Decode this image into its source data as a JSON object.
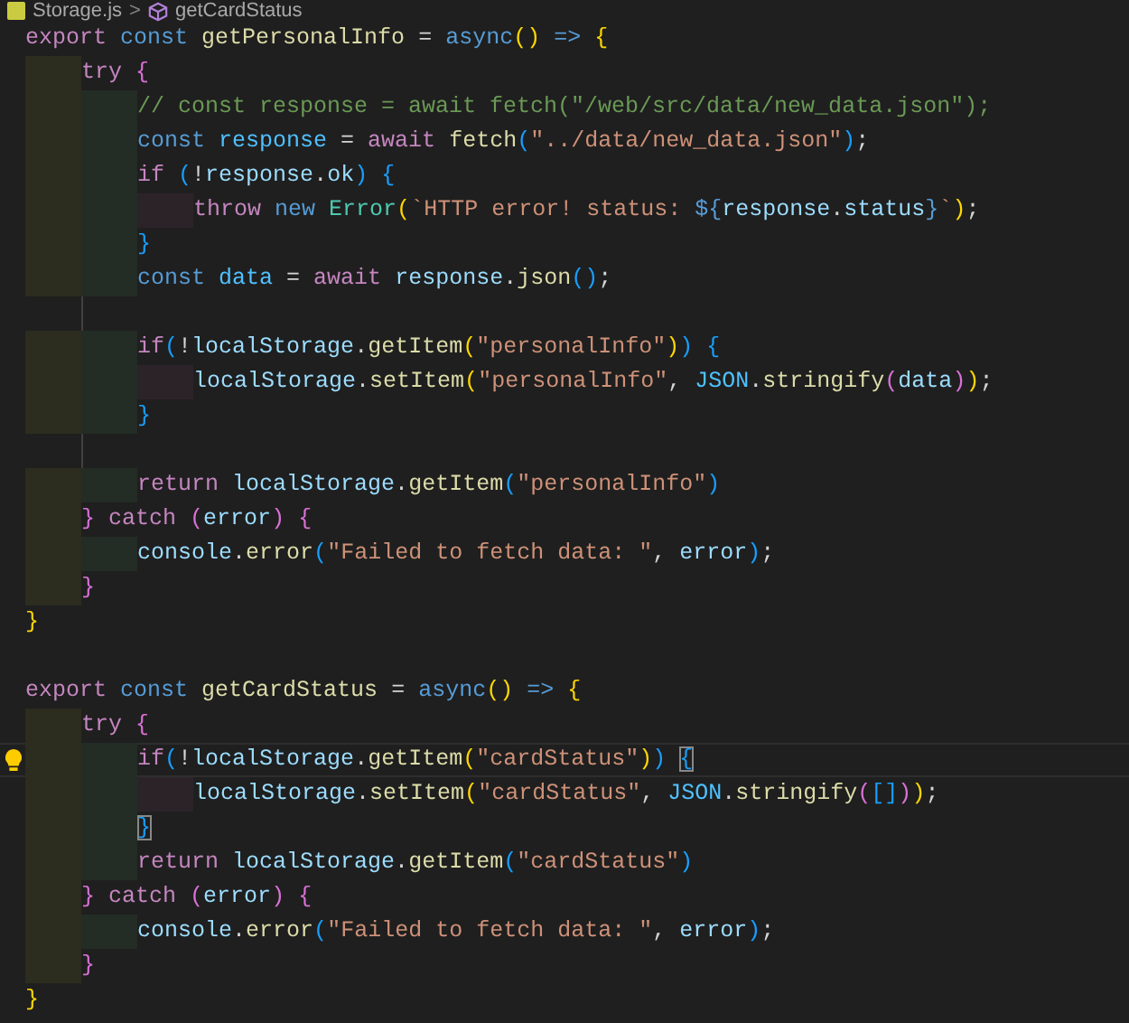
{
  "breadcrumb": {
    "file": "Storage.js",
    "separator": ">",
    "symbol": "getCardStatus"
  },
  "lines": [
    {
      "tokens": [
        {
          "t": "export",
          "kind": "control"
        },
        {
          "t": " const ",
          "kind": "keyword"
        },
        {
          "t": "getPersonalInfo",
          "kind": "function"
        },
        {
          "t": " = ",
          "kind": "plain"
        },
        {
          "t": "async",
          "kind": "keyword"
        },
        {
          "t": "()",
          "kind": "bracket1"
        },
        {
          "t": " => ",
          "kind": "keyword"
        },
        {
          "t": "{",
          "kind": "bracket1"
        }
      ]
    },
    {
      "guides": [
        {
          "color": "#2c2c1f"
        }
      ],
      "tokens": [
        {
          "t": "try",
          "kind": "control"
        },
        {
          "t": " {",
          "kind": "bracket2"
        }
      ]
    },
    {
      "guides": [
        {
          "color": "#2c2c1f"
        },
        {
          "color": "#232c25"
        }
      ],
      "tokens": [
        {
          "t": "// const response = await fetch(\"/web/src/data/new_data.json\");",
          "kind": "comment"
        }
      ]
    },
    {
      "guides": [
        {
          "color": "#2c2c1f"
        },
        {
          "color": "#232c25"
        }
      ],
      "tokens": [
        {
          "t": "const",
          "kind": "keyword"
        },
        {
          "t": " response",
          "kind": "constant"
        },
        {
          "t": " = ",
          "kind": "plain"
        },
        {
          "t": "await",
          "kind": "control"
        },
        {
          "t": " fetch",
          "kind": "function"
        },
        {
          "t": "(",
          "kind": "bracket3"
        },
        {
          "t": "\"../data/new_data.json\"",
          "kind": "string"
        },
        {
          "t": ")",
          "kind": "bracket3"
        },
        {
          "t": ";",
          "kind": "plain"
        }
      ]
    },
    {
      "guides": [
        {
          "color": "#2c2c1f"
        },
        {
          "color": "#232c25"
        }
      ],
      "tokens": [
        {
          "t": "if ",
          "kind": "control"
        },
        {
          "t": "(",
          "kind": "bracket3"
        },
        {
          "t": "!",
          "kind": "plain"
        },
        {
          "t": "response",
          "kind": "variable"
        },
        {
          "t": ".",
          "kind": "plain"
        },
        {
          "t": "ok",
          "kind": "variable"
        },
        {
          "t": ")",
          "kind": "bracket3"
        },
        {
          "t": " {",
          "kind": "bracket3"
        }
      ]
    },
    {
      "guides": [
        {
          "color": "#2c2c1f"
        },
        {
          "color": "#232c25"
        },
        {
          "color": "#2c2329"
        }
      ],
      "tokens": [
        {
          "t": "throw",
          "kind": "control"
        },
        {
          "t": " new ",
          "kind": "keyword"
        },
        {
          "t": "Error",
          "kind": "type"
        },
        {
          "t": "(",
          "kind": "bracket1"
        },
        {
          "t": "`HTTP error! status: ",
          "kind": "string"
        },
        {
          "t": "${",
          "kind": "keyword"
        },
        {
          "t": "response",
          "kind": "variable"
        },
        {
          "t": ".",
          "kind": "plain"
        },
        {
          "t": "status",
          "kind": "variable"
        },
        {
          "t": "}",
          "kind": "keyword"
        },
        {
          "t": "`",
          "kind": "string"
        },
        {
          "t": ")",
          "kind": "bracket1"
        },
        {
          "t": ";",
          "kind": "plain"
        }
      ]
    },
    {
      "guides": [
        {
          "color": "#2c2c1f"
        },
        {
          "color": "#232c25"
        }
      ],
      "tokens": [
        {
          "t": "}",
          "kind": "bracket3"
        }
      ]
    },
    {
      "guides": [
        {
          "color": "#2c2c1f"
        },
        {
          "color": "#232c25"
        }
      ],
      "tokens": [
        {
          "t": "const",
          "kind": "keyword"
        },
        {
          "t": " data",
          "kind": "constant"
        },
        {
          "t": " = ",
          "kind": "plain"
        },
        {
          "t": "await",
          "kind": "control"
        },
        {
          "t": " response",
          "kind": "variable"
        },
        {
          "t": ".",
          "kind": "plain"
        },
        {
          "t": "json",
          "kind": "function"
        },
        {
          "t": "()",
          "kind": "bracket3"
        },
        {
          "t": ";",
          "kind": "plain"
        }
      ]
    },
    {
      "guide_line": true
    },
    {
      "guides": [
        {
          "color": "#2c2c1f"
        },
        {
          "color": "#232c25"
        }
      ],
      "tokens": [
        {
          "t": "if",
          "kind": "control"
        },
        {
          "t": "(",
          "kind": "bracket3"
        },
        {
          "t": "!",
          "kind": "plain"
        },
        {
          "t": "localStorage",
          "kind": "variable"
        },
        {
          "t": ".",
          "kind": "plain"
        },
        {
          "t": "getItem",
          "kind": "function"
        },
        {
          "t": "(",
          "kind": "bracket1"
        },
        {
          "t": "\"personalInfo\"",
          "kind": "string"
        },
        {
          "t": ")",
          "kind": "bracket1"
        },
        {
          "t": ")",
          "kind": "bracket3"
        },
        {
          "t": " {",
          "kind": "bracket3"
        }
      ]
    },
    {
      "guides": [
        {
          "color": "#2c2c1f"
        },
        {
          "color": "#232c25"
        },
        {
          "color": "#2c2329"
        }
      ],
      "tokens": [
        {
          "t": "localStorage",
          "kind": "variable"
        },
        {
          "t": ".",
          "kind": "plain"
        },
        {
          "t": "setItem",
          "kind": "function"
        },
        {
          "t": "(",
          "kind": "bracket1"
        },
        {
          "t": "\"personalInfo\"",
          "kind": "string"
        },
        {
          "t": ", ",
          "kind": "plain"
        },
        {
          "t": "JSON",
          "kind": "constant"
        },
        {
          "t": ".",
          "kind": "plain"
        },
        {
          "t": "stringify",
          "kind": "function"
        },
        {
          "t": "(",
          "kind": "bracket2"
        },
        {
          "t": "data",
          "kind": "variable"
        },
        {
          "t": ")",
          "kind": "bracket2"
        },
        {
          "t": ")",
          "kind": "bracket1"
        },
        {
          "t": ";",
          "kind": "plain"
        }
      ]
    },
    {
      "guides": [
        {
          "color": "#2c2c1f"
        },
        {
          "color": "#232c25"
        }
      ],
      "tokens": [
        {
          "t": "}",
          "kind": "bracket3"
        }
      ]
    },
    {
      "guide_line": true
    },
    {
      "guides": [
        {
          "color": "#2c2c1f"
        },
        {
          "color": "#232c25"
        }
      ],
      "tokens": [
        {
          "t": "return",
          "kind": "control"
        },
        {
          "t": " localStorage",
          "kind": "variable"
        },
        {
          "t": ".",
          "kind": "plain"
        },
        {
          "t": "getItem",
          "kind": "function"
        },
        {
          "t": "(",
          "kind": "bracket3"
        },
        {
          "t": "\"personalInfo\"",
          "kind": "string"
        },
        {
          "t": ")",
          "kind": "bracket3"
        }
      ]
    },
    {
      "guides": [
        {
          "color": "#2c2c1f"
        }
      ],
      "tokens": [
        {
          "t": "}",
          "kind": "bracket2"
        },
        {
          "t": " catch ",
          "kind": "control"
        },
        {
          "t": "(",
          "kind": "bracket2"
        },
        {
          "t": "error",
          "kind": "variable"
        },
        {
          "t": ")",
          "kind": "bracket2"
        },
        {
          "t": " {",
          "kind": "bracket2"
        }
      ]
    },
    {
      "guides": [
        {
          "color": "#2c2c1f"
        },
        {
          "color": "#232c25"
        }
      ],
      "tokens": [
        {
          "t": "console",
          "kind": "variable"
        },
        {
          "t": ".",
          "kind": "plain"
        },
        {
          "t": "error",
          "kind": "function"
        },
        {
          "t": "(",
          "kind": "bracket3"
        },
        {
          "t": "\"Failed to fetch data: \"",
          "kind": "string"
        },
        {
          "t": ", ",
          "kind": "plain"
        },
        {
          "t": "error",
          "kind": "variable"
        },
        {
          "t": ")",
          "kind": "bracket3"
        },
        {
          "t": ";",
          "kind": "plain"
        }
      ]
    },
    {
      "guides": [
        {
          "color": "#2c2c1f"
        }
      ],
      "tokens": [
        {
          "t": "}",
          "kind": "bracket2"
        }
      ]
    },
    {
      "tokens": [
        {
          "t": "}",
          "kind": "bracket1"
        }
      ]
    },
    {
      "blank": true
    },
    {
      "tokens": [
        {
          "t": "export",
          "kind": "control"
        },
        {
          "t": " const ",
          "kind": "keyword"
        },
        {
          "t": "getCardStatus",
          "kind": "function"
        },
        {
          "t": " = ",
          "kind": "plain"
        },
        {
          "t": "async",
          "kind": "keyword"
        },
        {
          "t": "()",
          "kind": "bracket1"
        },
        {
          "t": " => ",
          "kind": "keyword"
        },
        {
          "t": "{",
          "kind": "bracket1"
        }
      ]
    },
    {
      "guides": [
        {
          "color": "#2c2c1f"
        }
      ],
      "tokens": [
        {
          "t": "try",
          "kind": "control"
        },
        {
          "t": " {",
          "kind": "bracket2"
        }
      ]
    },
    {
      "current": true,
      "lightbulb": true,
      "guides": [
        {
          "color": "#2c2c1f"
        },
        {
          "color": "#232c25"
        }
      ],
      "tokens": [
        {
          "t": "if",
          "kind": "control"
        },
        {
          "t": "(",
          "kind": "bracket3"
        },
        {
          "t": "!",
          "kind": "plain"
        },
        {
          "t": "localStorage",
          "kind": "variable"
        },
        {
          "t": ".",
          "kind": "plain"
        },
        {
          "t": "getItem",
          "kind": "function"
        },
        {
          "t": "(",
          "kind": "bracket1"
        },
        {
          "t": "\"cardStatus\"",
          "kind": "string"
        },
        {
          "t": ")",
          "kind": "bracket1"
        },
        {
          "t": ") ",
          "kind": "bracket3"
        },
        {
          "t": "{",
          "kind": "bracket3",
          "boxed": true
        }
      ]
    },
    {
      "guides": [
        {
          "color": "#2c2c1f"
        },
        {
          "color": "#232c25"
        },
        {
          "color": "#2c2329"
        }
      ],
      "tokens": [
        {
          "t": "localStorage",
          "kind": "variable"
        },
        {
          "t": ".",
          "kind": "plain"
        },
        {
          "t": "setItem",
          "kind": "function"
        },
        {
          "t": "(",
          "kind": "bracket1"
        },
        {
          "t": "\"cardStatus\"",
          "kind": "string"
        },
        {
          "t": ", ",
          "kind": "plain"
        },
        {
          "t": "JSON",
          "kind": "constant"
        },
        {
          "t": ".",
          "kind": "plain"
        },
        {
          "t": "stringify",
          "kind": "function"
        },
        {
          "t": "(",
          "kind": "bracket2"
        },
        {
          "t": "[]",
          "kind": "bracket3"
        },
        {
          "t": ")",
          "kind": "bracket2"
        },
        {
          "t": ")",
          "kind": "bracket1"
        },
        {
          "t": ";",
          "kind": "plain"
        }
      ]
    },
    {
      "guides": [
        {
          "color": "#2c2c1f"
        },
        {
          "color": "#232c25"
        }
      ],
      "tokens": [
        {
          "t": "}",
          "kind": "bracket3",
          "boxed": true
        }
      ]
    },
    {
      "guides": [
        {
          "color": "#2c2c1f"
        },
        {
          "color": "#232c25"
        }
      ],
      "tokens": [
        {
          "t": "return",
          "kind": "control"
        },
        {
          "t": " localStorage",
          "kind": "variable"
        },
        {
          "t": ".",
          "kind": "plain"
        },
        {
          "t": "getItem",
          "kind": "function"
        },
        {
          "t": "(",
          "kind": "bracket3"
        },
        {
          "t": "\"cardStatus\"",
          "kind": "string"
        },
        {
          "t": ")",
          "kind": "bracket3"
        }
      ]
    },
    {
      "guides": [
        {
          "color": "#2c2c1f"
        }
      ],
      "tokens": [
        {
          "t": "}",
          "kind": "bracket2"
        },
        {
          "t": " catch ",
          "kind": "control"
        },
        {
          "t": "(",
          "kind": "bracket2"
        },
        {
          "t": "error",
          "kind": "variable"
        },
        {
          "t": ")",
          "kind": "bracket2"
        },
        {
          "t": " {",
          "kind": "bracket2"
        }
      ]
    },
    {
      "guides": [
        {
          "color": "#2c2c1f"
        },
        {
          "color": "#232c25"
        }
      ],
      "tokens": [
        {
          "t": "console",
          "kind": "variable"
        },
        {
          "t": ".",
          "kind": "plain"
        },
        {
          "t": "error",
          "kind": "function"
        },
        {
          "t": "(",
          "kind": "bracket3"
        },
        {
          "t": "\"Failed to fetch data: \"",
          "kind": "string"
        },
        {
          "t": ", ",
          "kind": "plain"
        },
        {
          "t": "error",
          "kind": "variable"
        },
        {
          "t": ")",
          "kind": "bracket3"
        },
        {
          "t": ";",
          "kind": "plain"
        }
      ]
    },
    {
      "guides": [
        {
          "color": "#2c2c1f"
        }
      ],
      "tokens": [
        {
          "t": "}",
          "kind": "bracket2"
        }
      ]
    },
    {
      "tokens": [
        {
          "t": "}",
          "kind": "bracket1"
        }
      ]
    }
  ]
}
